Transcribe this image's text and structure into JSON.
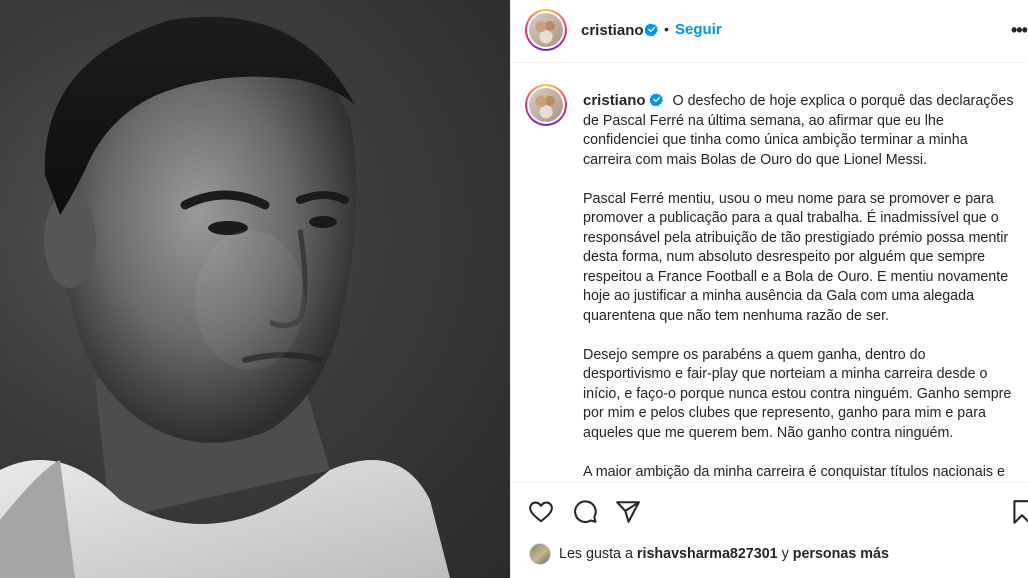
{
  "header": {
    "username": "cristiano",
    "separator": "•",
    "follow_label": "Seguir",
    "more_label": "•••"
  },
  "caption": {
    "username": "cristiano",
    "lines": [
      "O desfecho de hoje explica o porquê das declarações",
      "de Pascal Ferré na última semana, ao afirmar que eu lhe",
      "confidenciei que tinha como única ambição terminar a minha",
      "carreira com mais Bolas de Ouro do que Lionel Messi.",
      "",
      "Pascal Ferré mentiu, usou o meu nome para se promover e para",
      "promover a publicação para a qual trabalha. É inadmissível que o",
      "responsável pela atribuição de tão prestigiado prémio possa mentir",
      "desta forma, num absoluto desrespeito por alguém que sempre",
      "respeitou a France Football e a Bola de Ouro. E mentiu novamente",
      "hoje ao justificar a minha ausência da Gala com uma alegada",
      "quarentena que não tem nenhuma razão de ser.",
      "",
      "Desejo sempre os parabéns a quem ganha, dentro do",
      "desportivismo e fair-play que norteiam a minha carreira desde o",
      "início, e faço-o porque nunca estou contra ninguém. Ganho sempre",
      "por mim e pelos clubes que represento, ganho para mim e para",
      "aqueles que me querem bem. Não ganho contra ninguém.",
      "",
      "A maior ambição da minha carreira é conquistar títulos nacionais e"
    ]
  },
  "likes": {
    "prefix": "Les gusta a",
    "user": "rishavsharma827301",
    "connector": "y",
    "others": "personas más"
  },
  "icons": {
    "like": "heart-icon",
    "comment": "comment-icon",
    "share": "send-icon",
    "save": "bookmark-icon",
    "verified": "verified-badge-icon"
  },
  "colors": {
    "accent": "#0095f6",
    "text": "#262626",
    "divider": "#efefef"
  }
}
